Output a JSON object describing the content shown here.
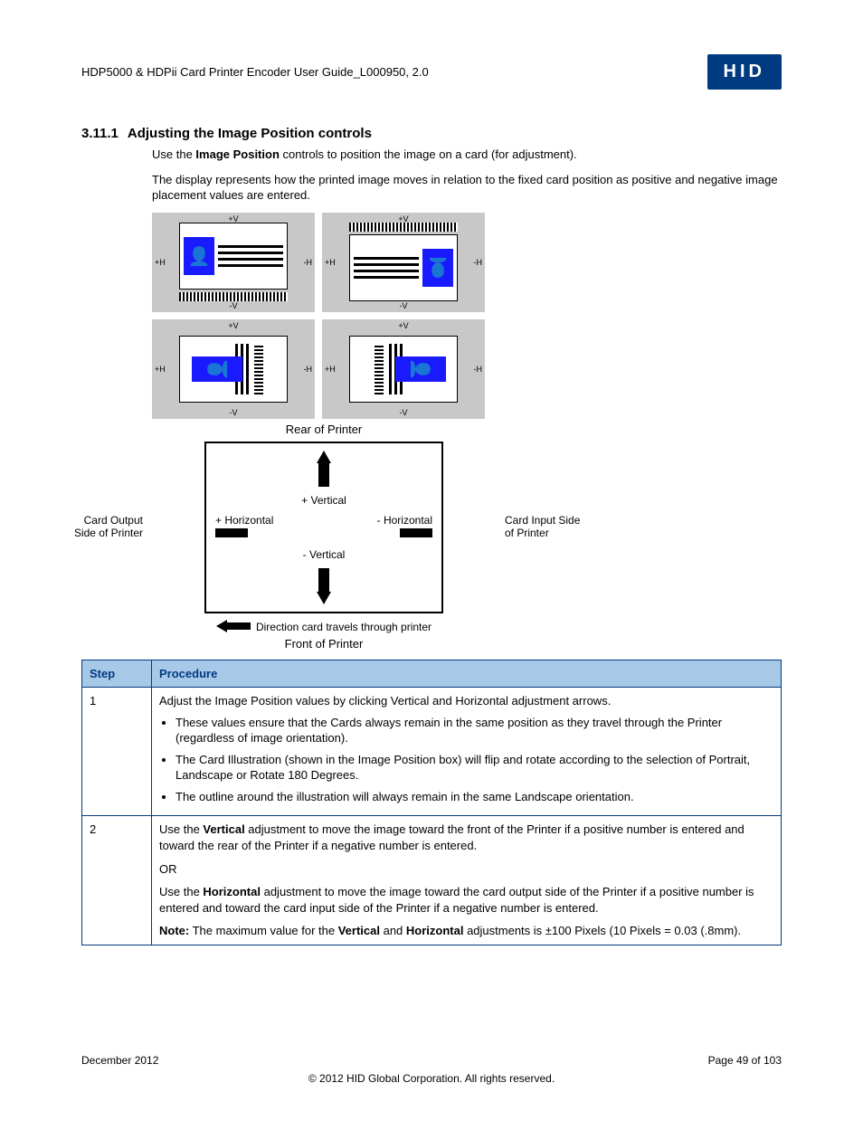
{
  "header": {
    "doc_title": "HDP5000 & HDPii Card Printer Encoder User Guide_L000950, 2.0",
    "logo_text": "HID"
  },
  "section": {
    "number": "3.11.1",
    "title": "Adjusting the Image Position controls",
    "intro_prefix": "Use the ",
    "intro_bold": "Image Position",
    "intro_suffix": " controls to position the image on a card (for adjustment).",
    "para2": "The display represents how the printed image moves in relation to the fixed card position as positive and negative image placement values are entered."
  },
  "diagram": {
    "axis_pv": "+V",
    "axis_nv": "-V",
    "axis_ph": "+H",
    "axis_nh": "-H",
    "rear_label": "Rear of Printer",
    "front_label": "Front of Printer",
    "plus_vertical": "+ Vertical",
    "minus_vertical": "- Vertical",
    "plus_horizontal": "+ Horizontal",
    "minus_horizontal": "- Horizontal",
    "card_output": "Card Output Side of Printer",
    "card_input": "Card Input Side of Printer",
    "direction_caption": "Direction card travels through printer"
  },
  "table": {
    "col_step": "Step",
    "col_proc": "Procedure",
    "row1": {
      "step": "1",
      "line1": "Adjust the Image Position values by clicking Vertical and Horizontal adjustment arrows.",
      "b1": "These values ensure that the Cards always remain in the same position as they travel through the Printer (regardless of image orientation).",
      "b2": "The Card Illustration (shown in the Image Position box) will flip and rotate according to the selection of Portrait, Landscape or Rotate 180 Degrees.",
      "b3": "The outline around the illustration will always remain in the same Landscape orientation."
    },
    "row2": {
      "step": "2",
      "p1a": "Use the ",
      "p1b": "Vertical",
      "p1c": " adjustment to move the image toward the front of the Printer if a positive number is entered and toward the rear of the Printer if a negative number is entered.",
      "or": "OR",
      "p2a": "Use the ",
      "p2b": "Horizontal",
      "p2c": " adjustment to move the image toward the card output side of the Printer if a positive number is entered and toward the card input side of the Printer if a negative number is entered.",
      "note_label": "Note:",
      "note_a": "  The maximum value for the ",
      "note_v": "Vertical",
      "note_and": " and ",
      "note_h": "Horizontal",
      "note_tail": " adjustments is ±100 Pixels (10 Pixels = 0.03 (.8mm)."
    }
  },
  "footer": {
    "date": "December 2012",
    "page": "Page 49 of 103",
    "copyright": "© 2012 HID Global Corporation. All rights reserved."
  }
}
